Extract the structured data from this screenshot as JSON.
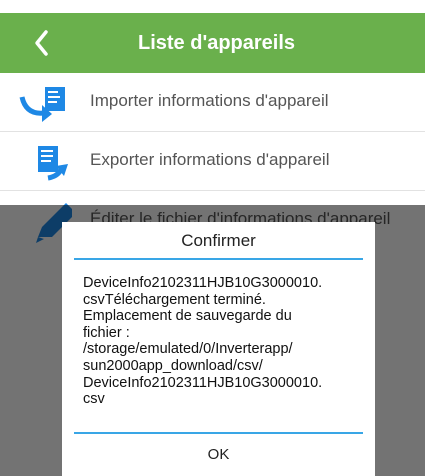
{
  "header": {
    "title": "Liste d'appareils",
    "back_icon": "chevron-left-icon",
    "color": "#6ab04c"
  },
  "list": [
    {
      "label": "Importer informations d'appareil",
      "icon": "import-icon"
    },
    {
      "label": "Exporter informations d'appareil",
      "icon": "export-icon"
    },
    {
      "label": "Éditer le fichier d'informations d'appareil",
      "icon": "pencil-icon"
    }
  ],
  "dialog": {
    "title": "Confirmer",
    "message": "DeviceInfo2102311HJB10G3000010.\ncsvTéléchargement terminé.\nEmplacement de sauvegarde du\nfichier :\n/storage/emulated/0/Inverterapp/\nsun2000app_download/csv/\nDeviceInfo2102311HJB10G3000010.\ncsv",
    "ok_label": "OK",
    "accent_color": "#39a6e6"
  },
  "icon_color": "#1e88e5"
}
